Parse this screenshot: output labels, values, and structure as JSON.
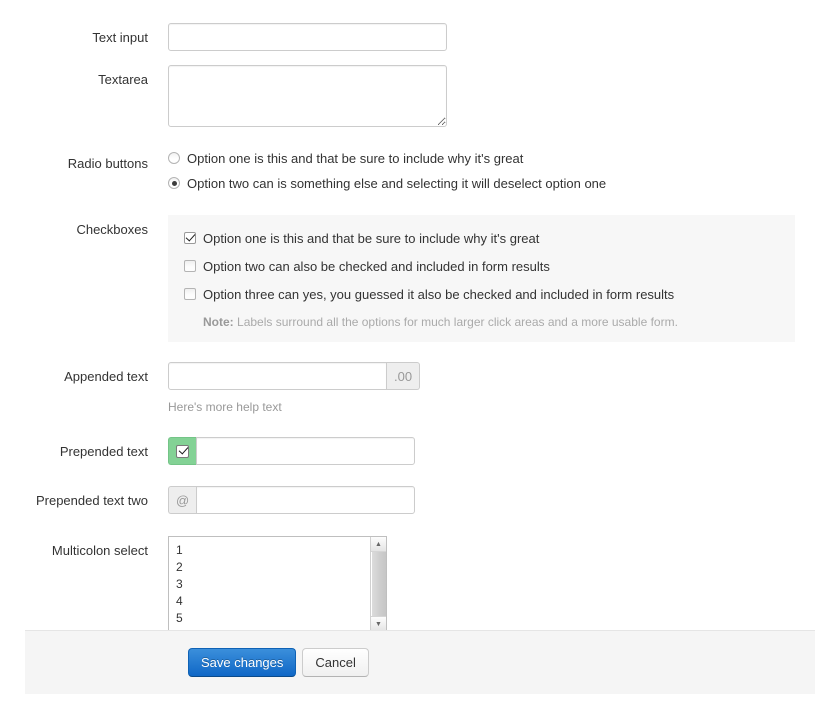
{
  "form": {
    "rows": {
      "text_input": {
        "label": "Text input",
        "value": "",
        "placeholder": ""
      },
      "textarea": {
        "label": "Textarea",
        "value": "",
        "placeholder": ""
      },
      "radio_buttons": {
        "label": "Radio buttons",
        "options": [
          {
            "text": "Option one is this and that be sure to include why it's great",
            "checked": false
          },
          {
            "text": "Option two can is something else and selecting it will deselect option one",
            "checked": true
          }
        ]
      },
      "checkboxes": {
        "label": "Checkboxes",
        "options": [
          {
            "text": "Option one is this and that be sure to include why it's great",
            "checked": true
          },
          {
            "text": "Option two can also be checked and included in form results",
            "checked": false
          },
          {
            "text": "Option three can yes, you guessed it also be checked and included in form results",
            "checked": false
          }
        ],
        "note_label": "Note:",
        "note_text": "Labels surround all the options for much larger click areas and a more usable form."
      },
      "appended_text": {
        "label": "Appended text",
        "value": "",
        "placeholder": "",
        "addon": ".00",
        "help_text": "Here's more help text"
      },
      "prepended_text": {
        "label": "Prepended text",
        "value": "",
        "placeholder": "",
        "addon_icon": "checkbox-checked-icon",
        "addon_color": "#83d295"
      },
      "prepended_text_two": {
        "label": "Prepended text two",
        "value": "",
        "placeholder": "",
        "addon": "@"
      },
      "multicolon_select": {
        "label": "Multicolon select",
        "options": [
          "1",
          "2",
          "3",
          "4",
          "5"
        ],
        "scroll_up_icon": "▲",
        "scroll_down_icon": "▼"
      }
    }
  },
  "footer": {
    "save_label": "Save changes",
    "cancel_label": "Cancel",
    "primary_color": "#0f67c6"
  }
}
